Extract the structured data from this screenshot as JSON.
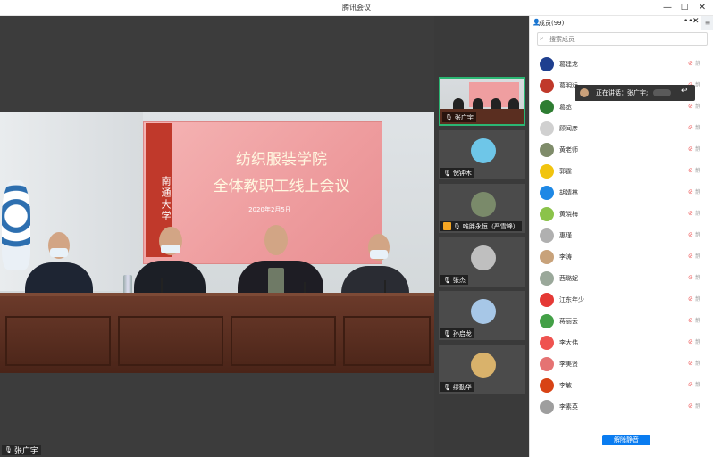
{
  "window": {
    "title": "腾讯会议",
    "minimize": "—",
    "maximize": "□",
    "close": "✕"
  },
  "main_video": {
    "speaker_name": "张广宇",
    "banner": {
      "line1": "纺织服装学院",
      "line2": "全体教职工线上会议",
      "date": "2020年2月5日",
      "plaque": "南通大学"
    }
  },
  "thumbnails": [
    {
      "name": "张广宇",
      "kind": "video",
      "mic": "on",
      "active": true
    },
    {
      "name": "倪钟木",
      "kind": "avatar",
      "mic": "on",
      "avatar_color": "#6ec6e8"
    },
    {
      "name": "唯胖永恒（严雪峰）",
      "kind": "avatar",
      "mic": "on",
      "avatar_color": "#7a8a6a",
      "sharing": true
    },
    {
      "name": "张杰",
      "kind": "avatar",
      "mic": "on",
      "avatar_color": "#bfbfbf"
    },
    {
      "name": "孙启龙",
      "kind": "avatar",
      "mic": "on",
      "avatar_color": "#a7c7e7"
    },
    {
      "name": "缪勤华",
      "kind": "avatar",
      "mic": "on",
      "avatar_color": "#d9b26b"
    }
  ],
  "members_panel": {
    "title": "成员(99)",
    "more": "•••",
    "close": "✕",
    "side": "≡",
    "search_placeholder": "搜索成员",
    "status_label": "静",
    "unmute_all_label": "解除静音",
    "members": [
      {
        "name": "葛建龙",
        "avatar_color": "#1f3f8f"
      },
      {
        "name": "葛明远",
        "avatar_color": "#c0392b"
      },
      {
        "name": "葛丞",
        "avatar_color": "#2e7d32"
      },
      {
        "name": "顾闻彦",
        "avatar_color": "#d0d0d0"
      },
      {
        "name": "黄老师",
        "avatar_color": "#7f8c6a"
      },
      {
        "name": "郭霆",
        "avatar_color": "#f1c40f"
      },
      {
        "name": "胡婧林",
        "avatar_color": "#1e88e5"
      },
      {
        "name": "黄晓梅",
        "avatar_color": "#8bc34a"
      },
      {
        "name": "惠瑾",
        "avatar_color": "#b0b0b0"
      },
      {
        "name": "李涛",
        "avatar_color": "#c8a27a"
      },
      {
        "name": "茜璐妮",
        "avatar_color": "#9aa89a"
      },
      {
        "name": "江东年少",
        "avatar_color": "#e53935"
      },
      {
        "name": "蒋丽云",
        "avatar_color": "#43a047"
      },
      {
        "name": "李大伟",
        "avatar_color": "#ef5350"
      },
      {
        "name": "李美贤",
        "avatar_color": "#e57373"
      },
      {
        "name": "李敏",
        "avatar_color": "#d84315"
      },
      {
        "name": "李素英",
        "avatar_color": "#9e9e9e"
      }
    ]
  },
  "speaking_tip": {
    "text": "正在讲话：张广宇;"
  },
  "colors": {
    "accent": "#0a7cf0",
    "active_border": "#2bb673",
    "muted": "#e55555",
    "thumb_bg": "#3a3a3a"
  }
}
